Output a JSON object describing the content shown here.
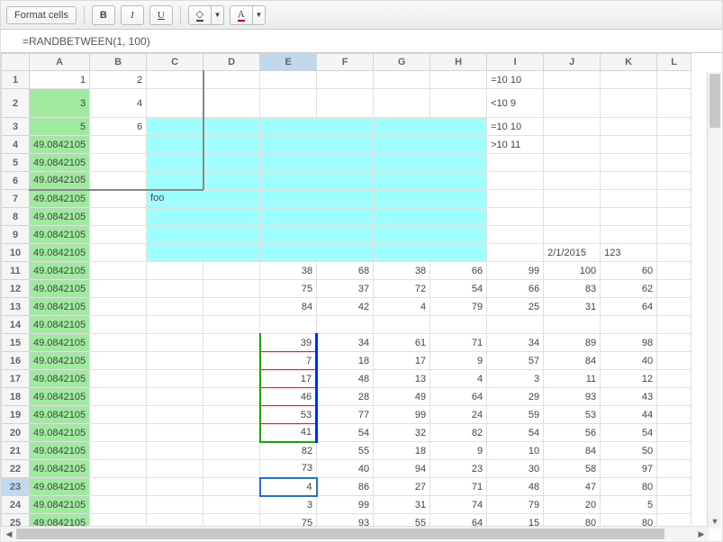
{
  "toolbar": {
    "format_cells": "Format cells",
    "bold": "B",
    "italic": "I",
    "underline": "U",
    "fill_icon": "◇",
    "font_color_icon": "A"
  },
  "formula": "=RANDBETWEEN(1, 100)",
  "columns": [
    "A",
    "B",
    "C",
    "D",
    "E",
    "F",
    "G",
    "H",
    "I",
    "J",
    "K",
    "L"
  ],
  "selected_column": "E",
  "selected_row": 23,
  "current_cell": "E23",
  "foo_label": "foo",
  "j10": "2/1/2015",
  "k10": "123",
  "colI": {
    "1": "=10 10",
    "2": "<10 9",
    "3": "=10 10",
    "4": ">10 11"
  },
  "colA": {
    "1": "1",
    "2": "3",
    "3": "5",
    "4": "49.0842105",
    "5": "49.0842105",
    "6": "49.0842105",
    "7": "49.0842105",
    "8": "49.0842105",
    "9": "49.0842105",
    "10": "49.0842105",
    "11": "49.0842105",
    "12": "49.0842105",
    "13": "49.0842105",
    "14": "49.0842105",
    "15": "49.0842105",
    "16": "49.0842105",
    "17": "49.0842105",
    "18": "49.0842105",
    "19": "49.0842105",
    "20": "49.0842105",
    "21": "49.0842105",
    "22": "49.0842105",
    "23": "49.0842105",
    "24": "49.0842105",
    "25": "49.0842105"
  },
  "colB": {
    "1": "2",
    "2": "4",
    "3": "6"
  },
  "data": {
    "11": {
      "E": "38",
      "F": "68",
      "G": "38",
      "H": "66",
      "I": "99",
      "J": "100",
      "K": "60"
    },
    "12": {
      "E": "75",
      "F": "37",
      "G": "72",
      "H": "54",
      "I": "66",
      "J": "83",
      "K": "62"
    },
    "13": {
      "E": "84",
      "F": "42",
      "G": "4",
      "H": "79",
      "I": "25",
      "J": "31",
      "K": "64"
    },
    "14": {
      "E": "",
      "F": "",
      "G": "",
      "H": "",
      "I": "",
      "J": "",
      "K": ""
    },
    "15": {
      "E": "39",
      "F": "34",
      "G": "61",
      "H": "71",
      "I": "34",
      "J": "89",
      "K": "98"
    },
    "16": {
      "E": "7",
      "F": "18",
      "G": "17",
      "H": "9",
      "I": "57",
      "J": "84",
      "K": "40"
    },
    "17": {
      "E": "17",
      "F": "48",
      "G": "13",
      "H": "4",
      "I": "3",
      "J": "11",
      "K": "12"
    },
    "18": {
      "E": "46",
      "F": "28",
      "G": "49",
      "H": "64",
      "I": "29",
      "J": "93",
      "K": "43"
    },
    "19": {
      "E": "53",
      "F": "77",
      "G": "99",
      "H": "24",
      "I": "59",
      "J": "53",
      "K": "44"
    },
    "20": {
      "E": "41",
      "F": "54",
      "G": "32",
      "H": "82",
      "I": "54",
      "J": "56",
      "K": "54"
    },
    "21": {
      "E": "82",
      "F": "55",
      "G": "18",
      "H": "9",
      "I": "10",
      "J": "84",
      "K": "50"
    },
    "22": {
      "E": "73",
      "F": "40",
      "G": "94",
      "H": "23",
      "I": "30",
      "J": "58",
      "K": "97"
    },
    "23": {
      "E": "4",
      "F": "86",
      "G": "27",
      "H": "71",
      "I": "48",
      "J": "47",
      "K": "80"
    },
    "24": {
      "E": "3",
      "F": "99",
      "G": "31",
      "H": "74",
      "I": "79",
      "J": "20",
      "K": "5"
    },
    "25": {
      "E": "75",
      "F": "93",
      "G": "55",
      "H": "64",
      "I": "15",
      "J": "80",
      "K": "80"
    }
  }
}
